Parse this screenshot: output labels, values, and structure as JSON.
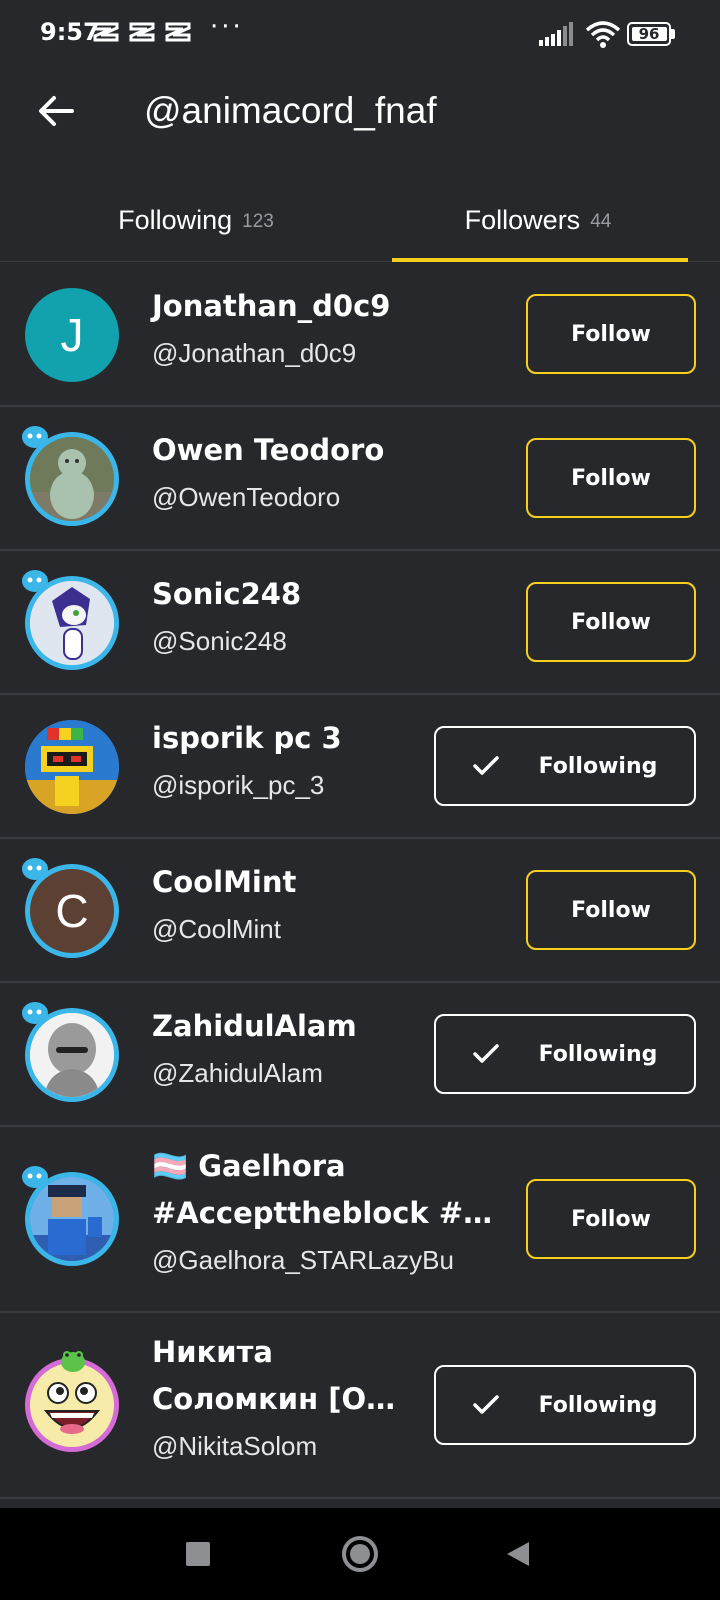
{
  "status_bar": {
    "time": "9:57",
    "overflow": "···",
    "battery_level": "96",
    "icons": [
      "capcut-notification-icon",
      "capcut-notification-icon",
      "capcut-notification-icon",
      "signal-icon",
      "wifi-icon",
      "battery-icon"
    ]
  },
  "header": {
    "title": "@animacord_fnaf",
    "back_icon": "arrow-left-icon"
  },
  "tabs": [
    {
      "label": "Following",
      "count": "123",
      "active": false
    },
    {
      "label": "Followers",
      "count": "44",
      "active": true
    }
  ],
  "accent_color": "#f7cf1c",
  "users": [
    {
      "display_name": "Jonathan_d0c9",
      "username": "@Jonathan_d0c9",
      "avatar_letter": "J",
      "avatar_color": "#11a2ad",
      "button": "Follow"
    },
    {
      "display_name": "Owen Teodoro",
      "username": "@OwenTeodoro",
      "avatar_letter": "",
      "avatar_color": "#5d6a50",
      "button": "Follow"
    },
    {
      "display_name": "Sonic248",
      "username": "@Sonic248",
      "avatar_letter": "",
      "avatar_color": "#dfe6ef",
      "button": "Follow"
    },
    {
      "display_name": "isporik pc 3",
      "username": "@isporik_pc_3",
      "avatar_letter": "",
      "avatar_color": "#2a7ad0",
      "button": "Following"
    },
    {
      "display_name": "CoolMint",
      "username": "@CoolMint",
      "avatar_letter": "C",
      "avatar_color": "#5c4033",
      "button": "Follow"
    },
    {
      "display_name": "ZahidulAlam",
      "username": "@ZahidulAlam",
      "avatar_letter": "",
      "avatar_color": "#f2f2f2",
      "button": "Following"
    },
    {
      "display_name": "🏳️‍⚧️ Gaelhora",
      "display_name_line2": "#Accepttheblock #…",
      "username": "@Gaelhora_STARLazyBu",
      "avatar_letter": "",
      "avatar_color": "#3f78c9",
      "button": "Follow"
    },
    {
      "display_name": "Никита",
      "display_name_line2": "Соломкин [О…",
      "username": "@NikitaSolom",
      "avatar_letter": "",
      "avatar_color": "#f5e6a8",
      "button": "Following"
    }
  ],
  "nav_bar": {
    "icons": [
      "recents-square-icon",
      "home-circle-icon",
      "back-triangle-icon"
    ]
  }
}
